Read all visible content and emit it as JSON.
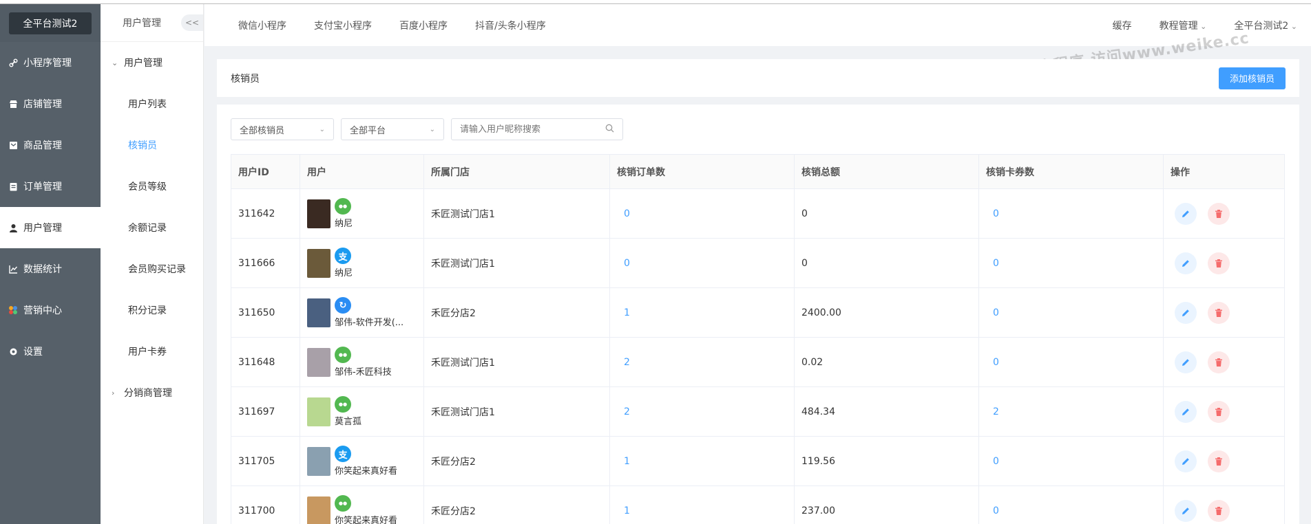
{
  "brand": "全平台测试2",
  "sidebar": {
    "items": [
      {
        "label": "小程序管理",
        "icon": "link-icon"
      },
      {
        "label": "店铺管理",
        "icon": "shop-icon"
      },
      {
        "label": "商品管理",
        "icon": "goods-icon"
      },
      {
        "label": "订单管理",
        "icon": "order-icon"
      },
      {
        "label": "用户管理",
        "icon": "user-icon"
      },
      {
        "label": "数据统计",
        "icon": "chart-icon"
      },
      {
        "label": "营销中心",
        "icon": "marketing-icon"
      },
      {
        "label": "设置",
        "icon": "gear-icon"
      }
    ]
  },
  "subsidebar": {
    "title": "用户管理",
    "collapse": "<<",
    "group1": "用户管理",
    "items": [
      "用户列表",
      "核销员",
      "会员等级",
      "余额记录",
      "会员购买记录",
      "积分记录",
      "用户卡券"
    ],
    "group2": "分销商管理"
  },
  "topnav": {
    "tabs": [
      "微信小程序",
      "支付宝小程序",
      "百度小程序",
      "抖音/头条小程序"
    ],
    "cache": "缓存",
    "tutorial": "教程管理",
    "account": "全平台测试2"
  },
  "watermark": "商城小程序 访问www.weike.cc",
  "page": {
    "title": "核销员",
    "add_button": "添加核销员"
  },
  "filters": {
    "type": "全部核销员",
    "platform": "全部平台",
    "search_placeholder": "请输入用户昵称搜索"
  },
  "table": {
    "headers": [
      "用户ID",
      "用户",
      "所属门店",
      "核销订单数",
      "核销总额",
      "核销卡券数",
      "操作"
    ],
    "rows": [
      {
        "id": "311642",
        "platform": "wechat",
        "name": "纳尼",
        "store": "禾匠测试门店1",
        "orders": "0",
        "total": "0",
        "cards": "0"
      },
      {
        "id": "311666",
        "platform": "alipay",
        "name": "纳尼",
        "store": "禾匠测试门店1",
        "orders": "0",
        "total": "0",
        "cards": "0"
      },
      {
        "id": "311650",
        "platform": "baidu",
        "name": "邹伟-软件开发(...",
        "store": "禾匠分店2",
        "orders": "1",
        "total": "2400.00",
        "cards": "0"
      },
      {
        "id": "311648",
        "platform": "wechat",
        "name": "邹伟-禾匠科技",
        "store": "禾匠测试门店1",
        "orders": "2",
        "total": "0.02",
        "cards": "0"
      },
      {
        "id": "311697",
        "platform": "wechat",
        "name": "莫言孤",
        "store": "禾匠测试门店1",
        "orders": "2",
        "total": "484.34",
        "cards": "2"
      },
      {
        "id": "311705",
        "platform": "alipay",
        "name": "你笑起来真好看",
        "store": "禾匠分店2",
        "orders": "1",
        "total": "119.56",
        "cards": "0"
      },
      {
        "id": "311700",
        "platform": "wechat",
        "name": "你笑起来真好看",
        "store": "禾匠分店2",
        "orders": "1",
        "total": "237.00",
        "cards": "0"
      }
    ]
  },
  "colors": {
    "accent": "#409eff",
    "sidebar": "#566069",
    "wechat": "#52b850",
    "alipay": "#1a9bf0",
    "danger": "#f56c6c"
  }
}
